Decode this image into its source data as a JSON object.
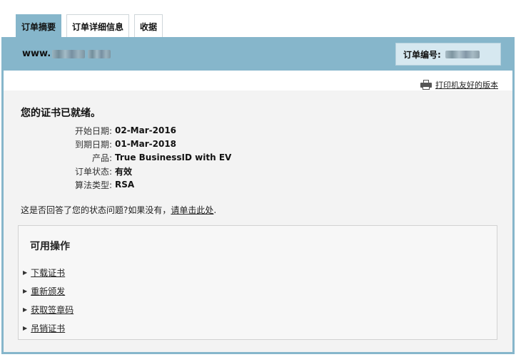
{
  "tabs": [
    {
      "label": "订单摘要",
      "active": true
    },
    {
      "label": "订单详细信息",
      "active": false
    },
    {
      "label": "收据",
      "active": false
    }
  ],
  "header": {
    "domain_prefix": "www.",
    "order_number_label": "订单编号:"
  },
  "print_link": "打印机友好的版本",
  "status_title": "您的证书已就绪。",
  "details": [
    {
      "label": "开始日期:",
      "value": "02-Mar-2016"
    },
    {
      "label": "到期日期:",
      "value": "01-Mar-2018"
    },
    {
      "label": "产品:",
      "value": "True BusinessID with EV"
    },
    {
      "label": "订单状态:",
      "value": "有效"
    },
    {
      "label": "算法类型:",
      "value": "RSA"
    }
  ],
  "question": {
    "text": "这是否回答了您的状态问题?如果没有，",
    "link": "请单击此处",
    "suffix": "."
  },
  "actions": {
    "title": "可用操作",
    "items": [
      "下载证书",
      "重新颁发",
      "获取签章码",
      "吊销证书"
    ]
  },
  "colors": {
    "accent": "#86b6cb",
    "order_box": "#d6e8f0",
    "panel_bg": "#f3f3f3"
  }
}
